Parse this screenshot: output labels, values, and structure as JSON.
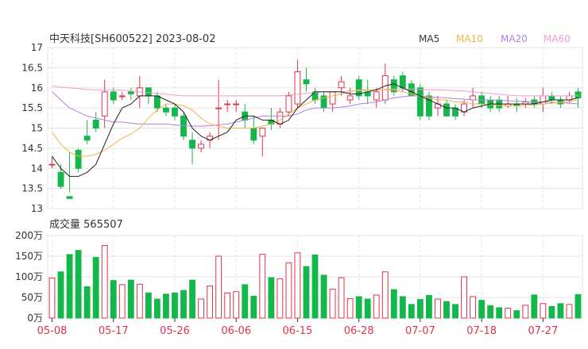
{
  "colors": {
    "up": "#e0344a",
    "down": "#14b84a",
    "ma5": "#222222",
    "ma10": "#f2b544",
    "ma20": "#b37fe0",
    "ma60": "#f19ad0",
    "grid": "#e3e3e3",
    "axis": "#333333",
    "date": "#e0344a"
  },
  "chart_data": [
    {
      "type": "candlestick",
      "title": "中天科技[SH600522] 2023-08-02",
      "x": [
        "05-08",
        "05-09",
        "05-10",
        "05-11",
        "05-12",
        "05-15",
        "05-16",
        "05-17",
        "05-18",
        "05-19",
        "05-22",
        "05-23",
        "05-24",
        "05-25",
        "05-26",
        "05-29",
        "05-30",
        "05-31",
        "06-01",
        "06-02",
        "06-05",
        "06-06",
        "06-07",
        "06-08",
        "06-09",
        "06-12",
        "06-13",
        "06-14",
        "06-15",
        "06-16",
        "06-19",
        "06-20",
        "06-21",
        "06-26",
        "06-27",
        "06-28",
        "06-29",
        "06-30",
        "07-03",
        "07-04",
        "07-05",
        "07-06",
        "07-07",
        "07-10",
        "07-11",
        "07-12",
        "07-13",
        "07-14",
        "07-17",
        "07-18",
        "07-19",
        "07-20",
        "07-21",
        "07-24",
        "07-25",
        "07-26",
        "07-27",
        "07-28",
        "07-31",
        "08-01",
        "08-02"
      ],
      "open": [
        14.1,
        13.9,
        13.3,
        14.45,
        14.8,
        15.2,
        15.3,
        15.9,
        15.8,
        15.9,
        15.8,
        16.0,
        15.8,
        15.5,
        15.5,
        15.3,
        14.7,
        14.5,
        14.7,
        15.5,
        15.6,
        15.6,
        15.4,
        15.0,
        14.8,
        15.2,
        15.1,
        15.4,
        15.6,
        16.2,
        15.9,
        15.8,
        15.6,
        16.0,
        15.7,
        16.2,
        15.9,
        15.7,
        15.7,
        16.2,
        16.3,
        16.1,
        16.0,
        15.8,
        15.5,
        15.6,
        15.5,
        15.4,
        15.7,
        15.8,
        15.7,
        15.7,
        15.55,
        15.6,
        15.6,
        15.7,
        15.6,
        15.8,
        15.7,
        15.7,
        15.9
      ],
      "close": [
        14.1,
        13.55,
        13.25,
        14.0,
        14.7,
        15.0,
        15.9,
        15.7,
        15.8,
        15.85,
        16.0,
        15.8,
        15.5,
        15.4,
        15.3,
        14.8,
        14.5,
        14.6,
        14.8,
        15.5,
        15.6,
        15.6,
        15.2,
        14.7,
        15.0,
        15.1,
        15.4,
        15.8,
        16.4,
        16.1,
        15.7,
        15.5,
        15.9,
        16.15,
        15.8,
        15.8,
        15.8,
        15.9,
        16.3,
        15.9,
        16.0,
        15.8,
        15.3,
        15.3,
        15.6,
        15.3,
        15.3,
        15.6,
        15.8,
        15.6,
        15.5,
        15.5,
        15.6,
        15.55,
        15.65,
        15.6,
        15.8,
        15.7,
        15.6,
        15.8,
        15.75
      ],
      "high": [
        14.3,
        14.1,
        14.4,
        14.5,
        15.2,
        15.4,
        16.2,
        16.0,
        15.9,
        16.0,
        16.3,
        16.0,
        15.9,
        15.6,
        15.6,
        15.4,
        14.9,
        14.7,
        14.9,
        16.2,
        15.7,
        15.7,
        15.6,
        15.3,
        14.9,
        15.5,
        15.5,
        15.9,
        16.7,
        16.5,
        16.0,
        15.9,
        15.9,
        16.3,
        16.0,
        16.3,
        16.2,
        16.0,
        16.6,
        16.3,
        16.4,
        16.2,
        16.1,
        15.9,
        15.8,
        15.7,
        15.6,
        15.7,
        16.0,
        15.9,
        15.8,
        15.8,
        15.8,
        15.75,
        15.75,
        15.8,
        16.0,
        15.9,
        15.8,
        15.9,
        16.0
      ],
      "low": [
        14.0,
        13.5,
        13.4,
        13.9,
        14.6,
        14.9,
        15.0,
        15.6,
        15.7,
        15.7,
        15.5,
        15.6,
        15.4,
        15.3,
        15.2,
        14.7,
        14.1,
        14.4,
        14.5,
        14.7,
        15.4,
        15.4,
        15.0,
        14.6,
        14.3,
        14.95,
        15.0,
        15.3,
        15.5,
        15.9,
        15.6,
        15.4,
        15.4,
        15.8,
        15.6,
        15.7,
        15.6,
        15.5,
        15.6,
        15.8,
        15.9,
        15.8,
        15.2,
        15.2,
        15.3,
        15.3,
        15.2,
        15.3,
        15.5,
        15.5,
        15.4,
        15.4,
        15.5,
        15.4,
        15.5,
        15.5,
        15.4,
        15.6,
        15.5,
        15.6,
        15.5
      ],
      "legend": [
        "MA5",
        "MA10",
        "MA20",
        "MA60"
      ],
      "ma5": [
        14.3,
        14.0,
        13.8,
        13.8,
        13.9,
        14.1,
        14.6,
        15.1,
        15.5,
        15.6,
        15.8,
        15.8,
        15.8,
        15.7,
        15.6,
        15.4,
        15.0,
        14.8,
        14.7,
        14.8,
        14.9,
        15.2,
        15.3,
        15.3,
        15.2,
        15.2,
        15.1,
        15.2,
        15.5,
        15.7,
        15.9,
        15.9,
        15.9,
        15.9,
        15.85,
        15.85,
        15.9,
        15.95,
        16.05,
        16.1,
        16.0,
        15.9,
        15.8,
        15.7,
        15.6,
        15.5,
        15.5,
        15.4,
        15.5,
        15.55,
        15.6,
        15.6,
        15.6,
        15.6,
        15.6,
        15.6,
        15.65,
        15.7,
        15.7,
        15.7,
        15.75
      ],
      "ma10": [
        14.9,
        14.6,
        14.4,
        14.3,
        14.3,
        14.35,
        14.45,
        14.6,
        14.75,
        14.85,
        15.0,
        15.25,
        15.45,
        15.6,
        15.6,
        15.55,
        15.45,
        15.25,
        15.1,
        15.05,
        15.0,
        15.0,
        15.0,
        15.0,
        15.05,
        15.1,
        15.2,
        15.35,
        15.5,
        15.6,
        15.7,
        15.75,
        15.8,
        15.85,
        15.9,
        15.95,
        15.95,
        15.95,
        15.95,
        15.95,
        15.9,
        15.85,
        15.8,
        15.75,
        15.7,
        15.7,
        15.65,
        15.65,
        15.6,
        15.6,
        15.58,
        15.56,
        15.55,
        15.55,
        15.56,
        15.58,
        15.6,
        15.62,
        15.64,
        15.66,
        15.7
      ],
      "ma20": [
        15.9,
        15.7,
        15.5,
        15.4,
        15.3,
        15.25,
        15.2,
        15.15,
        15.15,
        15.12,
        15.1,
        15.1,
        15.1,
        15.1,
        15.08,
        15.06,
        15.05,
        15.05,
        15.06,
        15.08,
        15.1,
        15.15,
        15.2,
        15.25,
        15.3,
        15.3,
        15.3,
        15.3,
        15.35,
        15.45,
        15.5,
        15.5,
        15.5,
        15.52,
        15.55,
        15.6,
        15.62,
        15.65,
        15.7,
        15.75,
        15.78,
        15.8,
        15.8,
        15.78,
        15.76,
        15.75,
        15.73,
        15.72,
        15.7,
        15.7,
        15.7,
        15.69,
        15.68,
        15.67,
        15.66,
        15.65,
        15.65,
        15.64,
        15.63,
        15.62,
        15.6
      ],
      "ma60": [
        16.05,
        16.02,
        16.0,
        15.98,
        15.96,
        15.95,
        15.95,
        15.95,
        15.94,
        15.92,
        15.9,
        15.88,
        15.86,
        15.84,
        15.82,
        15.8,
        15.8,
        15.8,
        15.8,
        15.8,
        15.8,
        15.8,
        15.8,
        15.8,
        15.8,
        15.8,
        15.8,
        15.82,
        15.84,
        15.86,
        15.88,
        15.9,
        15.9,
        15.9,
        15.92,
        15.93,
        15.94,
        15.95,
        15.96,
        15.97,
        15.97,
        15.97,
        15.96,
        15.95,
        15.95,
        15.94,
        15.93,
        15.92,
        15.9,
        15.88,
        15.86,
        15.84,
        15.82,
        15.8,
        15.8,
        15.8,
        15.8,
        15.8,
        15.8,
        15.8,
        15.8
      ],
      "ylim": [
        13,
        17
      ],
      "yticks": [
        "13",
        "13.5",
        "14",
        "14.5",
        "15",
        "15.5",
        "16",
        "16.5",
        "17"
      ],
      "xticks": [
        "05-08",
        "05-17",
        "05-26",
        "06-06",
        "06-15",
        "06-28",
        "07-07",
        "07-18",
        "07-27"
      ]
    },
    {
      "type": "bar",
      "title": "成交量 565507",
      "x": [
        "05-08",
        "05-09",
        "05-10",
        "05-11",
        "05-12",
        "05-15",
        "05-16",
        "05-17",
        "05-18",
        "05-19",
        "05-22",
        "05-23",
        "05-24",
        "05-25",
        "05-26",
        "05-29",
        "05-30",
        "05-31",
        "06-01",
        "06-02",
        "06-05",
        "06-06",
        "06-07",
        "06-08",
        "06-09",
        "06-12",
        "06-13",
        "06-14",
        "06-15",
        "06-16",
        "06-19",
        "06-20",
        "06-21",
        "06-26",
        "06-27",
        "06-28",
        "06-29",
        "06-30",
        "07-03",
        "07-04",
        "07-05",
        "07-06",
        "07-07",
        "07-10",
        "07-11",
        "07-12",
        "07-13",
        "07-14",
        "07-17",
        "07-18",
        "07-19",
        "07-20",
        "07-21",
        "07-24",
        "07-25",
        "07-26",
        "07-27",
        "07-28",
        "07-31",
        "08-01",
        "08-02"
      ],
      "values": [
        970000,
        1120000,
        1540000,
        1640000,
        760000,
        1470000,
        1760000,
        910000,
        810000,
        920000,
        820000,
        610000,
        460000,
        580000,
        610000,
        670000,
        920000,
        460000,
        780000,
        1500000,
        610000,
        640000,
        810000,
        530000,
        1550000,
        980000,
        950000,
        1340000,
        1580000,
        1250000,
        1530000,
        1040000,
        700000,
        980000,
        470000,
        520000,
        460000,
        560000,
        1120000,
        690000,
        520000,
        330000,
        450000,
        550000,
        460000,
        400000,
        330000,
        1000000,
        520000,
        430000,
        300000,
        250000,
        240000,
        180000,
        310000,
        560000,
        350000,
        280000,
        350000,
        330000,
        570000
      ],
      "ylim": [
        0,
        2000000
      ],
      "yticks": [
        "0万",
        "50万",
        "100万",
        "150万",
        "200万"
      ]
    }
  ]
}
